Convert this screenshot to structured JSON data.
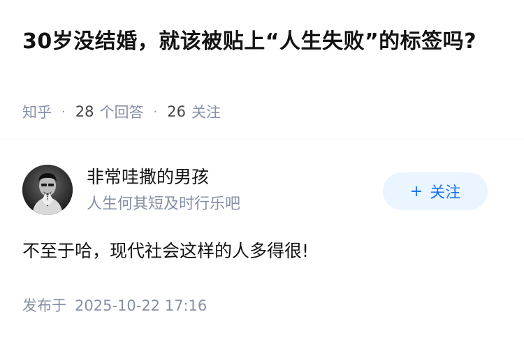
{
  "question": {
    "title": "30岁没结婚，就该被贴上“人生失败”的标签吗?",
    "source": "知乎",
    "separator": "·",
    "answer_count": "28",
    "answer_label": "个回答",
    "follow_count": "26",
    "follow_label": "关注"
  },
  "answer": {
    "author": {
      "name": "非常哇撒的男孩",
      "bio": "人生何其短及时行乐吧",
      "avatar_icon": "avatar-photo"
    },
    "follow_button": {
      "icon": "+",
      "label": "关注"
    },
    "content": "不至于哈，现代社会这样的人多得很!",
    "published_label": "发布于",
    "published_time": "2025-10-22 17:16"
  },
  "colors": {
    "accent": "#1772f6",
    "follow_bg": "#ebf5ff",
    "meta_text": "#8590a6"
  }
}
